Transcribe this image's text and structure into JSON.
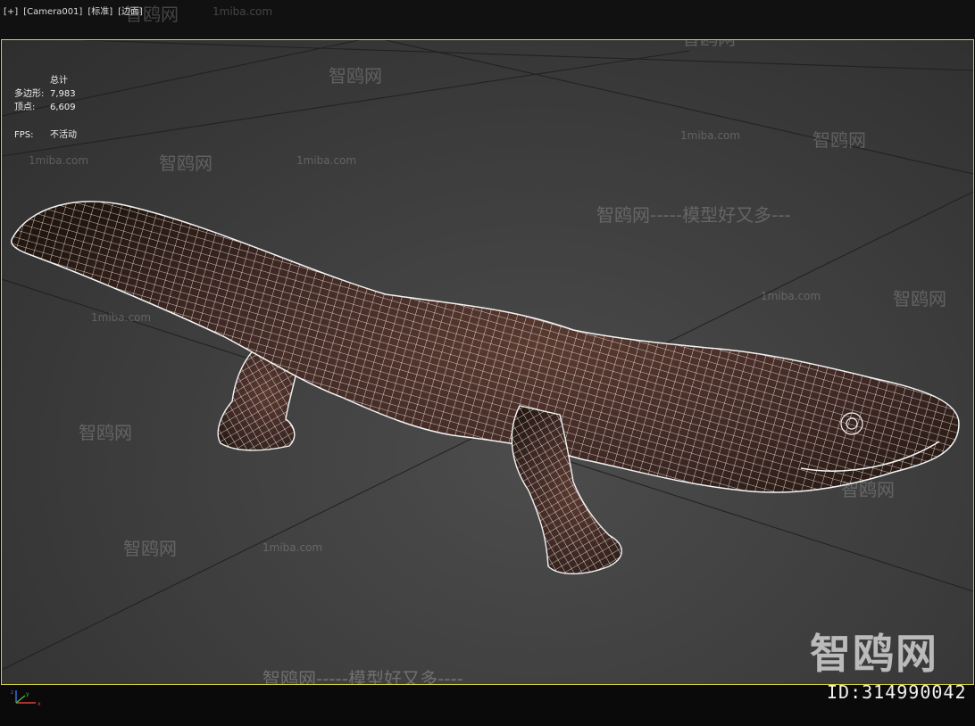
{
  "viewport_label": {
    "plus": "[+]",
    "camera": "[Camera001]",
    "shading": "[标准]",
    "display": "[边面]"
  },
  "stats": {
    "total_label": "总计",
    "polys_label": "多边形:",
    "polys_value": "7,983",
    "verts_label": "顶点:",
    "verts_value": "6,609",
    "fps_label": "FPS:",
    "fps_value": "不活动"
  },
  "watermarks": {
    "site_name": "智鸥网",
    "site_url": "1miba.com",
    "slogan": "智鸥网-----模型好又多---",
    "slogan_bottom": "智鸥网-----模型好又多----",
    "brand_big": "智鸥网",
    "id_text": "ID:314990042"
  },
  "colors": {
    "viewport_border": "#d7d23a",
    "wire": "#f4f4f4",
    "skin": "#4a2e26"
  },
  "axis_gizmo": {
    "x": "x",
    "y": "y",
    "z": "z"
  }
}
